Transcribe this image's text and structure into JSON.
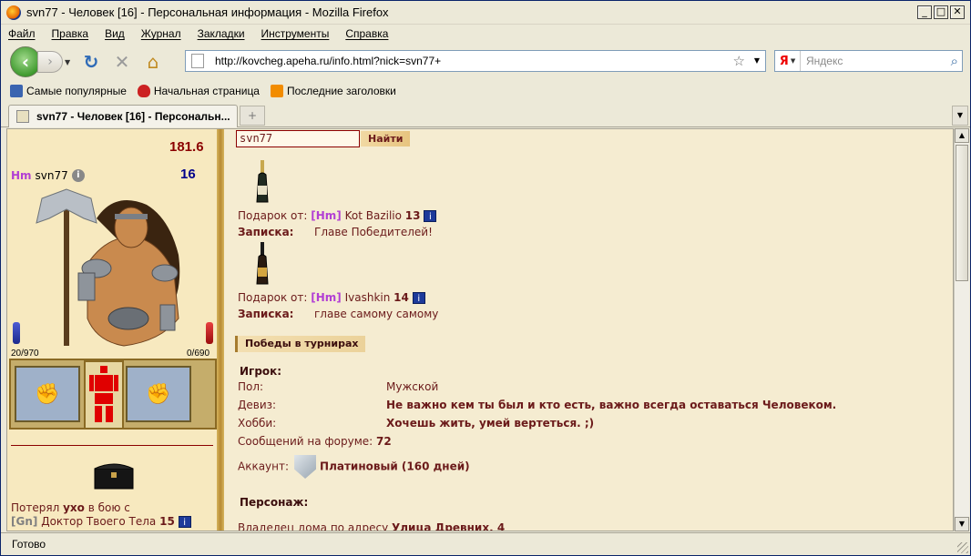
{
  "window": {
    "title": "svn77 - Человек [16] - Персональная информация - Mozilla Firefox",
    "minimize": "_",
    "maximize": "□",
    "close": "✕"
  },
  "menu": [
    "Файл",
    "Правка",
    "Вид",
    "Журнал",
    "Закладки",
    "Инструменты",
    "Справка"
  ],
  "nav": {
    "url": "http://kovcheg.apeha.ru/info.html?nick=svn77+",
    "search_placeholder": "Яндекс",
    "search_engine": "Я"
  },
  "bookmarks": [
    "Самые популярные",
    "Начальная страница",
    "Последние заголовки"
  ],
  "tab": {
    "title": "svn77 - Человек [16] - Персональн..."
  },
  "character": {
    "weight": "181.6",
    "clan": "Hm",
    "nick": "svn77",
    "level": "16",
    "hp": "20/970",
    "mp": "0/690",
    "lost_prefix": "Потерял",
    "lost_item": "ухо",
    "lost_suffix": "в бою с",
    "opponent_clan": "[Gn]",
    "opponent_nick": "Доктор Твоего Тела",
    "opponent_level": "15",
    "info_glyph": "i"
  },
  "search_form": {
    "nick_value": "svn77",
    "find_label": "Найти"
  },
  "gifts": [
    {
      "from_label": "Подарок от:",
      "clan": "[Hm]",
      "nick": "Kot Bazilio",
      "level": "13",
      "note_label": "Записка:",
      "note": "Главе Победителей!"
    },
    {
      "from_label": "Подарок от:",
      "clan": "[Hm]",
      "nick": "Ivashkin",
      "level": "14",
      "note_label": "Записка:",
      "note": "главе самому самому"
    }
  ],
  "tournaments_header": "Победы в турнирах",
  "player": {
    "header": "Игрок:",
    "fields": [
      {
        "label": "Пол:",
        "value": "Мужской"
      },
      {
        "label": "Девиз:",
        "value": "Не важно кем ты был и кто есть, важно всегда оставаться Человеком."
      },
      {
        "label": "Хобби:",
        "value": "Хочешь жить, умей вертеться. ;)"
      }
    ],
    "forum_label": "Сообщений на форуме:",
    "forum_value": "72",
    "account_label": "Аккаунт:",
    "account_value": "Платиновый (160 дней)"
  },
  "persona": {
    "header": "Персонаж:",
    "house_label": "Владелец дома по адресу",
    "house_value": "Улица Древних, 4"
  },
  "status": "Готово",
  "colors": {
    "text_dark_red": "#6b1a1a",
    "clan_purple": "#b23fd4",
    "weight_red": "#8b0000",
    "level_blue": "#00008b"
  }
}
